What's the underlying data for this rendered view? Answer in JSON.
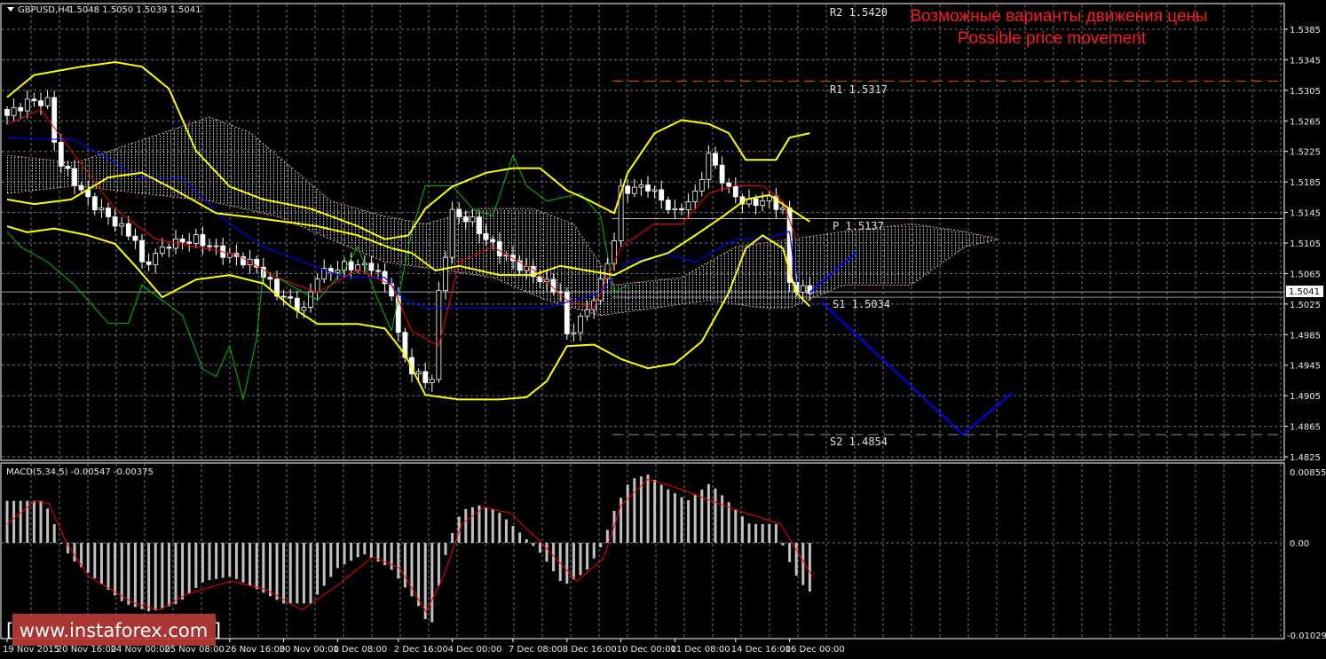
{
  "header": {
    "symbol": "GBPUSD,H4",
    "ohlc": "1.5048 1.5050 1.5039 1.5041"
  },
  "annotation": {
    "line1": "Возможные варианты движения цены",
    "line2": "Possible price movement"
  },
  "levels": [
    {
      "label": "R2 1.5420",
      "price": 1.542,
      "style": "dashed",
      "color": "#ff3b00"
    },
    {
      "label": "R1 1.5317",
      "price": 1.5317,
      "style": "dashed",
      "color": "#ff3b00"
    },
    {
      "label": "P 1.5137",
      "price": 1.5137,
      "style": "solid",
      "color": "#b8b8a8"
    },
    {
      "label": "S1 1.5034",
      "price": 1.5034,
      "style": "solid",
      "color": "#909090"
    },
    {
      "label": "S2 1.4854",
      "price": 1.4854,
      "style": "dashed",
      "color": "#909090"
    }
  ],
  "current_price": "1.5041",
  "watermark": "[ www.instaforex.com ]",
  "macd": {
    "label": "MACD(5,34,5) -0.00547 -0.00375",
    "ticks": [
      "0.00855",
      "0.00",
      "-0.01029"
    ]
  },
  "chart_data": {
    "type": "candlestick",
    "title": "GBPUSD,H4",
    "ylim": [
      1.4825,
      1.5385
    ],
    "y_ticks": [
      "1.5385",
      "1.5345",
      "1.5305",
      "1.5265",
      "1.5225",
      "1.5185",
      "1.5145",
      "1.5105",
      "1.5065",
      "1.5025",
      "1.4985",
      "1.4945",
      "1.4905",
      "1.4865",
      "1.4825"
    ],
    "x_ticks": [
      "19 Nov 2015",
      "20 Nov 16:00",
      "24 Nov 00:00",
      "25 Nov 08:00",
      "26 Nov 16:00",
      "30 Nov 00:00",
      "1 Dec 08:00",
      "2 Dec 16:00",
      "4 Dec 00:00",
      "7 Dec 08:00",
      "8 Dec 16:00",
      "10 Dec 00:00",
      "11 Dec 08:00",
      "14 Dec 16:00",
      "16 Dec 00:00"
    ],
    "x_tick_bars": [
      0,
      8,
      16,
      24,
      33,
      41,
      49,
      58,
      66,
      75,
      83,
      91,
      99,
      108,
      116
    ],
    "bars": 120,
    "close_path": [
      [
        0,
        1.5272
      ],
      [
        3,
        1.529
      ],
      [
        6,
        1.529
      ],
      [
        7.5,
        1.5214
      ],
      [
        9.5,
        1.5191
      ],
      [
        12,
        1.5162
      ],
      [
        15,
        1.5139
      ],
      [
        19,
        1.511
      ],
      [
        20,
        1.5075
      ],
      [
        24,
        1.5104
      ],
      [
        28,
        1.511
      ],
      [
        32,
        1.5092
      ],
      [
        37,
        1.5075
      ],
      [
        40,
        1.504
      ],
      [
        44,
        1.5017
      ],
      [
        46,
        1.5063
      ],
      [
        50,
        1.5075
      ],
      [
        54,
        1.5075
      ],
      [
        57,
        1.504
      ],
      [
        58,
        1.4982
      ],
      [
        60,
        1.4935
      ],
      [
        63,
        1.4924
      ],
      [
        64,
        1.504
      ],
      [
        66,
        1.5144
      ],
      [
        69,
        1.5133
      ],
      [
        71,
        1.511
      ],
      [
        74,
        1.5086
      ],
      [
        78,
        1.5063
      ],
      [
        82,
        1.504
      ],
      [
        83,
        1.4982
      ],
      [
        86,
        1.5017
      ],
      [
        88,
        1.5052
      ],
      [
        90,
        1.511
      ],
      [
        91,
        1.5174
      ],
      [
        95,
        1.5179
      ],
      [
        99,
        1.5144
      ],
      [
        102,
        1.5168
      ],
      [
        104,
        1.522
      ],
      [
        107,
        1.5174
      ],
      [
        109.5,
        1.5156
      ],
      [
        113,
        1.5162
      ],
      [
        115.5,
        1.5144
      ],
      [
        116,
        1.5052
      ],
      [
        117,
        1.5046
      ],
      [
        119,
        1.5041
      ]
    ],
    "bollinger": {
      "upper": [
        [
          0,
          1.5296
        ],
        [
          4,
          1.5325
        ],
        [
          11,
          1.5336
        ],
        [
          16,
          1.5342
        ],
        [
          20,
          1.5336
        ],
        [
          24,
          1.5307
        ],
        [
          28,
          1.5226
        ],
        [
          33,
          1.5179
        ],
        [
          38,
          1.5162
        ],
        [
          45,
          1.515
        ],
        [
          52,
          1.5127
        ],
        [
          56,
          1.511
        ],
        [
          59.5,
          1.5115
        ],
        [
          62,
          1.515
        ],
        [
          66,
          1.5179
        ],
        [
          71,
          1.5197
        ],
        [
          75,
          1.5203
        ],
        [
          79,
          1.5203
        ],
        [
          83,
          1.5174
        ],
        [
          86,
          1.5162
        ],
        [
          90,
          1.5144
        ],
        [
          92,
          1.5197
        ],
        [
          96,
          1.5249
        ],
        [
          100,
          1.5266
        ],
        [
          104,
          1.5261
        ],
        [
          107,
          1.5249
        ],
        [
          109.5,
          1.5214
        ],
        [
          114,
          1.5214
        ],
        [
          116,
          1.5243
        ],
        [
          119,
          1.5249
        ]
      ],
      "middle": [
        [
          0,
          1.5162
        ],
        [
          4,
          1.5156
        ],
        [
          9.5,
          1.5162
        ],
        [
          15,
          1.5191
        ],
        [
          20,
          1.5197
        ],
        [
          25,
          1.5174
        ],
        [
          31,
          1.5144
        ],
        [
          36,
          1.5139
        ],
        [
          41,
          1.5133
        ],
        [
          46,
          1.5127
        ],
        [
          52,
          1.5115
        ],
        [
          57,
          1.5098
        ],
        [
          60,
          1.5092
        ],
        [
          63.5,
          1.5069
        ],
        [
          67,
          1.5075
        ],
        [
          73,
          1.5063
        ],
        [
          78,
          1.5063
        ],
        [
          82,
          1.5075
        ],
        [
          86,
          1.5069
        ],
        [
          90,
          1.5063
        ],
        [
          94,
          1.5081
        ],
        [
          98,
          1.5092
        ],
        [
          102,
          1.5115
        ],
        [
          106,
          1.5139
        ],
        [
          109.5,
          1.5162
        ],
        [
          113,
          1.5168
        ],
        [
          116,
          1.515
        ],
        [
          119,
          1.5133
        ]
      ],
      "lower": [
        [
          0,
          1.5127
        ],
        [
          3,
          1.5119
        ],
        [
          7,
          1.5124
        ],
        [
          12,
          1.5115
        ],
        [
          16,
          1.5104
        ],
        [
          19,
          1.5075
        ],
        [
          23,
          1.5034
        ],
        [
          28,
          1.5057
        ],
        [
          33,
          1.5063
        ],
        [
          38,
          1.5052
        ],
        [
          42,
          1.5022
        ],
        [
          46,
          1.4999
        ],
        [
          52,
          1.4999
        ],
        [
          56,
          1.4993
        ],
        [
          59,
          1.4959
        ],
        [
          62,
          1.4906
        ],
        [
          67,
          1.49
        ],
        [
          73,
          1.49
        ],
        [
          77,
          1.4903
        ],
        [
          80,
          1.4924
        ],
        [
          83,
          1.497
        ],
        [
          87,
          1.4972
        ],
        [
          91,
          1.4953
        ],
        [
          95,
          1.4941
        ],
        [
          99,
          1.4947
        ],
        [
          103,
          1.4976
        ],
        [
          107,
          1.504
        ],
        [
          109.5,
          1.5098
        ],
        [
          112,
          1.5115
        ],
        [
          115,
          1.5098
        ],
        [
          117,
          1.504
        ],
        [
          119,
          1.5022
        ]
      ]
    },
    "ichimoku": {
      "tenkan": [
        [
          0,
          1.526
        ],
        [
          5,
          1.528
        ],
        [
          10,
          1.522
        ],
        [
          16,
          1.515
        ],
        [
          22,
          1.511
        ],
        [
          28,
          1.51
        ],
        [
          34,
          1.509
        ],
        [
          40,
          1.506
        ],
        [
          46,
          1.504
        ],
        [
          52,
          1.507
        ],
        [
          57,
          1.505
        ],
        [
          60,
          1.499
        ],
        [
          64,
          1.497
        ],
        [
          67,
          1.508
        ],
        [
          72,
          1.51
        ],
        [
          78,
          1.507
        ],
        [
          83,
          1.503
        ],
        [
          87,
          1.502
        ],
        [
          91,
          1.51
        ],
        [
          96,
          1.513
        ],
        [
          100,
          1.513
        ],
        [
          104,
          1.517
        ],
        [
          108,
          1.518
        ],
        [
          112,
          1.518
        ],
        [
          115,
          1.516
        ],
        [
          117,
          1.511
        ]
      ],
      "kijun": [
        [
          0,
          1.5243
        ],
        [
          10,
          1.524
        ],
        [
          16,
          1.521
        ],
        [
          20,
          1.519
        ],
        [
          26,
          1.519
        ],
        [
          33,
          1.513
        ],
        [
          38,
          1.51
        ],
        [
          44,
          1.508
        ],
        [
          50,
          1.506
        ],
        [
          56,
          1.506
        ],
        [
          59,
          1.503
        ],
        [
          62,
          1.502
        ],
        [
          80,
          1.502
        ],
        [
          88,
          1.504
        ],
        [
          92,
          1.508
        ],
        [
          98,
          1.509
        ],
        [
          102,
          1.508
        ],
        [
          108,
          1.511
        ],
        [
          112,
          1.511
        ],
        [
          116,
          1.512
        ],
        [
          117,
          1.505
        ]
      ],
      "chikou": [
        [
          0,
          1.512
        ],
        [
          2,
          1.51
        ],
        [
          6,
          1.508
        ],
        [
          10,
          1.505
        ],
        [
          15,
          1.5
        ],
        [
          18,
          1.5
        ],
        [
          20,
          1.505
        ],
        [
          26,
          1.501
        ],
        [
          29,
          1.494
        ],
        [
          31,
          1.493
        ],
        [
          33,
          1.497
        ],
        [
          35,
          1.49
        ],
        [
          37,
          1.498
        ],
        [
          38,
          1.507
        ],
        [
          44,
          1.504
        ],
        [
          46,
          1.503
        ],
        [
          50,
          1.507
        ],
        [
          52,
          1.51
        ],
        [
          55,
          1.503
        ],
        [
          57,
          1.499
        ],
        [
          60,
          1.512
        ],
        [
          62,
          1.518
        ],
        [
          66,
          1.518
        ],
        [
          69,
          1.515
        ],
        [
          72,
          1.514
        ],
        [
          75,
          1.522
        ],
        [
          77,
          1.518
        ],
        [
          80,
          1.516
        ],
        [
          85,
          1.517
        ],
        [
          88,
          1.514
        ],
        [
          90,
          1.504
        ],
        [
          92,
          1.505
        ]
      ],
      "cloud_upper": [
        [
          0,
          1.522
        ],
        [
          10,
          1.521
        ],
        [
          20,
          1.524
        ],
        [
          30,
          1.527
        ],
        [
          36,
          1.525
        ],
        [
          44,
          1.519
        ],
        [
          48,
          1.516
        ],
        [
          56,
          1.514
        ],
        [
          62,
          1.513
        ],
        [
          70,
          1.515
        ],
        [
          78,
          1.515
        ],
        [
          84,
          1.513
        ],
        [
          90,
          1.505
        ],
        [
          100,
          1.506
        ],
        [
          108,
          1.51
        ],
        [
          116,
          1.511
        ],
        [
          124,
          1.512
        ],
        [
          134,
          1.513
        ],
        [
          142,
          1.512
        ],
        [
          147,
          1.511
        ]
      ],
      "cloud_lower": [
        [
          0,
          1.517
        ],
        [
          10,
          1.518
        ],
        [
          20,
          1.517
        ],
        [
          30,
          1.516
        ],
        [
          40,
          1.514
        ],
        [
          48,
          1.511
        ],
        [
          56,
          1.508
        ],
        [
          64,
          1.507
        ],
        [
          72,
          1.506
        ],
        [
          80,
          1.503
        ],
        [
          88,
          1.501
        ],
        [
          96,
          1.502
        ],
        [
          104,
          1.503
        ],
        [
          112,
          1.502
        ],
        [
          116,
          1.502
        ],
        [
          124,
          1.505
        ],
        [
          134,
          1.505
        ],
        [
          142,
          1.51
        ],
        [
          147,
          1.511
        ]
      ]
    },
    "forecast": {
      "up": [
        [
          119,
          1.504
        ],
        [
          126,
          1.5094
        ]
      ],
      "down": [
        [
          120.7,
          1.5028
        ],
        [
          141.7,
          1.4854
        ],
        [
          149,
          1.4909
        ]
      ]
    },
    "macd": {
      "ylim": [
        -0.01029,
        0.00855
      ],
      "histogram": [
        [
          0,
          0.0045
        ],
        [
          5.5,
          0.0045
        ],
        [
          7,
          0.002
        ],
        [
          8,
          0
        ],
        [
          9.5,
          -0.0017
        ],
        [
          13.5,
          -0.0041
        ],
        [
          17.4,
          -0.0065
        ],
        [
          21.3,
          -0.0074
        ],
        [
          25.3,
          -0.0065
        ],
        [
          29.2,
          -0.0041
        ],
        [
          33.2,
          -0.0036
        ],
        [
          37.1,
          -0.005
        ],
        [
          41,
          -0.0065
        ],
        [
          45,
          -0.0065
        ],
        [
          49,
          -0.0027
        ],
        [
          52.9,
          -0.0012
        ],
        [
          56.8,
          -0.0027
        ],
        [
          60.8,
          -0.0065
        ],
        [
          62.8,
          -0.0093
        ],
        [
          64,
          -0.0046
        ],
        [
          65.4,
          0
        ],
        [
          67.4,
          0.0035
        ],
        [
          70,
          0.004
        ],
        [
          72.6,
          0.0035
        ],
        [
          75.3,
          0.0016
        ],
        [
          79.2,
          -0.0012
        ],
        [
          82.5,
          -0.0046
        ],
        [
          85.8,
          -0.0031
        ],
        [
          88.4,
          0
        ],
        [
          89.7,
          0.003
        ],
        [
          92.4,
          0.0068
        ],
        [
          95,
          0.0073
        ],
        [
          97.6,
          0.0059
        ],
        [
          100.9,
          0.0045
        ],
        [
          104.2,
          0.0064
        ],
        [
          106.8,
          0.0045
        ],
        [
          110.1,
          0.002
        ],
        [
          114,
          0.002
        ],
        [
          115.4,
          -0.0012
        ],
        [
          117.4,
          -0.0041
        ],
        [
          119.4,
          -0.0055
        ]
      ],
      "signal": [
        [
          0,
          0.002
        ],
        [
          4.2,
          0.0045
        ],
        [
          6.2,
          0.0042
        ],
        [
          8.8,
          0
        ],
        [
          12.1,
          -0.0036
        ],
        [
          18.7,
          -0.0064
        ],
        [
          22.6,
          -0.0072
        ],
        [
          26.6,
          -0.0055
        ],
        [
          33.2,
          -0.0041
        ],
        [
          38.4,
          -0.005
        ],
        [
          43.7,
          -0.0072
        ],
        [
          48.9,
          -0.0046
        ],
        [
          54.2,
          -0.0015
        ],
        [
          58.2,
          -0.0027
        ],
        [
          62.1,
          -0.0074
        ],
        [
          64.7,
          -0.0036
        ],
        [
          67.4,
          0.002
        ],
        [
          70.7,
          0.0038
        ],
        [
          74.6,
          0.0032
        ],
        [
          79.2,
          0
        ],
        [
          84.5,
          -0.0041
        ],
        [
          88.4,
          -0.0017
        ],
        [
          91,
          0.004
        ],
        [
          95,
          0.0068
        ],
        [
          98.9,
          0.006
        ],
        [
          102.9,
          0.0049
        ],
        [
          108.2,
          0.0035
        ],
        [
          114.7,
          0.002
        ],
        [
          119.4,
          -0.0036
        ]
      ]
    },
    "colors": {
      "bollinger": "#ffff00",
      "tenkan": "#ff0000",
      "kijun": "#0000ff",
      "chikou": "#00c000",
      "forecast": "#0000ff",
      "macd_hist": "#c0c0c0",
      "macd_signal": "#ff0000",
      "grid": "#6b7785"
    }
  }
}
